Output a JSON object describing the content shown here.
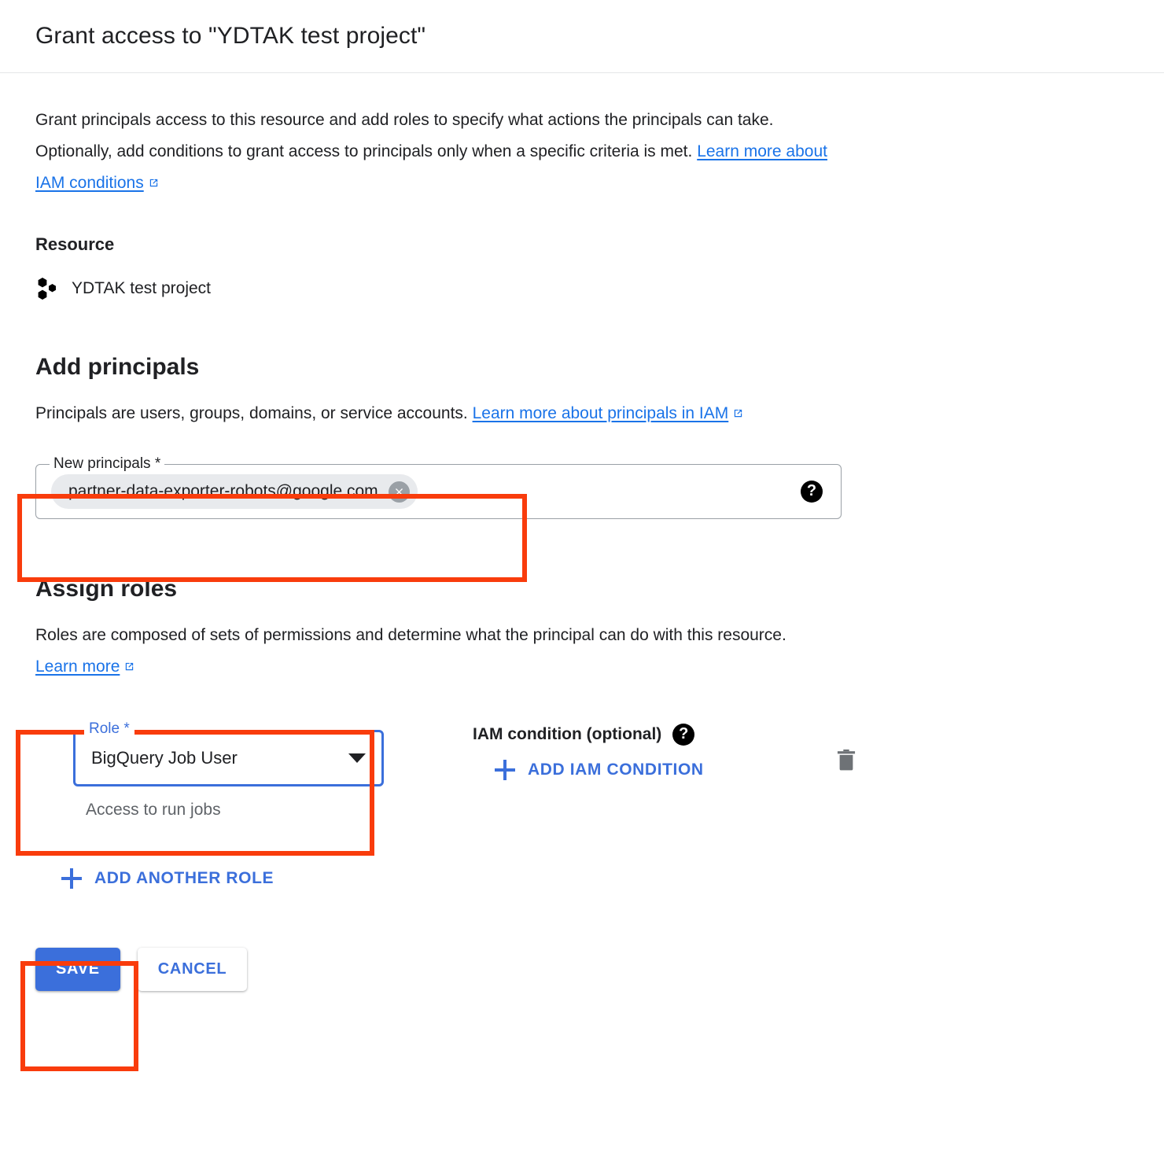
{
  "dialog": {
    "title": "Grant access to \"YDTAK test project\"",
    "intro_text_before_link": "Grant principals access to this resource and add roles to specify what actions the principals can take. Optionally, add conditions to grant access to principals only when a specific criteria is met.",
    "intro_link": "Learn more about IAM conditions"
  },
  "resource": {
    "heading": "Resource",
    "icon": "gcp-project-icon",
    "name": "YDTAK test project"
  },
  "principals": {
    "heading": "Add principals",
    "description_before_link": "Principals are users, groups, domains, or service accounts.",
    "description_link": "Learn more about principals in IAM",
    "field_label": "New principals *",
    "chip_value": "partner-data-exporter-robots@google.com",
    "chip_remove_icon": "close-circle-icon",
    "help_icon": "help-icon"
  },
  "roles": {
    "heading": "Assign roles",
    "description_before_link": "Roles are composed of sets of permissions and determine what the principal can do with this resource.",
    "description_link": "Learn more",
    "role_label": "Role *",
    "role_value": "BigQuery Job User",
    "role_hint": "Access to run jobs",
    "dropdown_icon": "chevron-down-icon",
    "condition_label": "IAM condition (optional)",
    "condition_help_icon": "help-icon",
    "add_condition_label": "ADD IAM CONDITION",
    "add_condition_icon": "plus-icon",
    "delete_icon": "trash-icon",
    "add_another_role_label": "ADD ANOTHER ROLE",
    "add_another_role_icon": "plus-icon"
  },
  "actions": {
    "save_label": "SAVE",
    "cancel_label": "CANCEL"
  },
  "annotations": {
    "highlight_color": "#f93c0c",
    "targets": [
      "new-principals-field",
      "role-select",
      "save-button"
    ]
  },
  "colors": {
    "accent_blue": "#3b6fdb",
    "link_blue": "#1a73e8",
    "text_primary": "#202124",
    "text_secondary": "#5f6368",
    "chip_bg": "#e8eaed",
    "highlight_red": "#f93c0c"
  }
}
